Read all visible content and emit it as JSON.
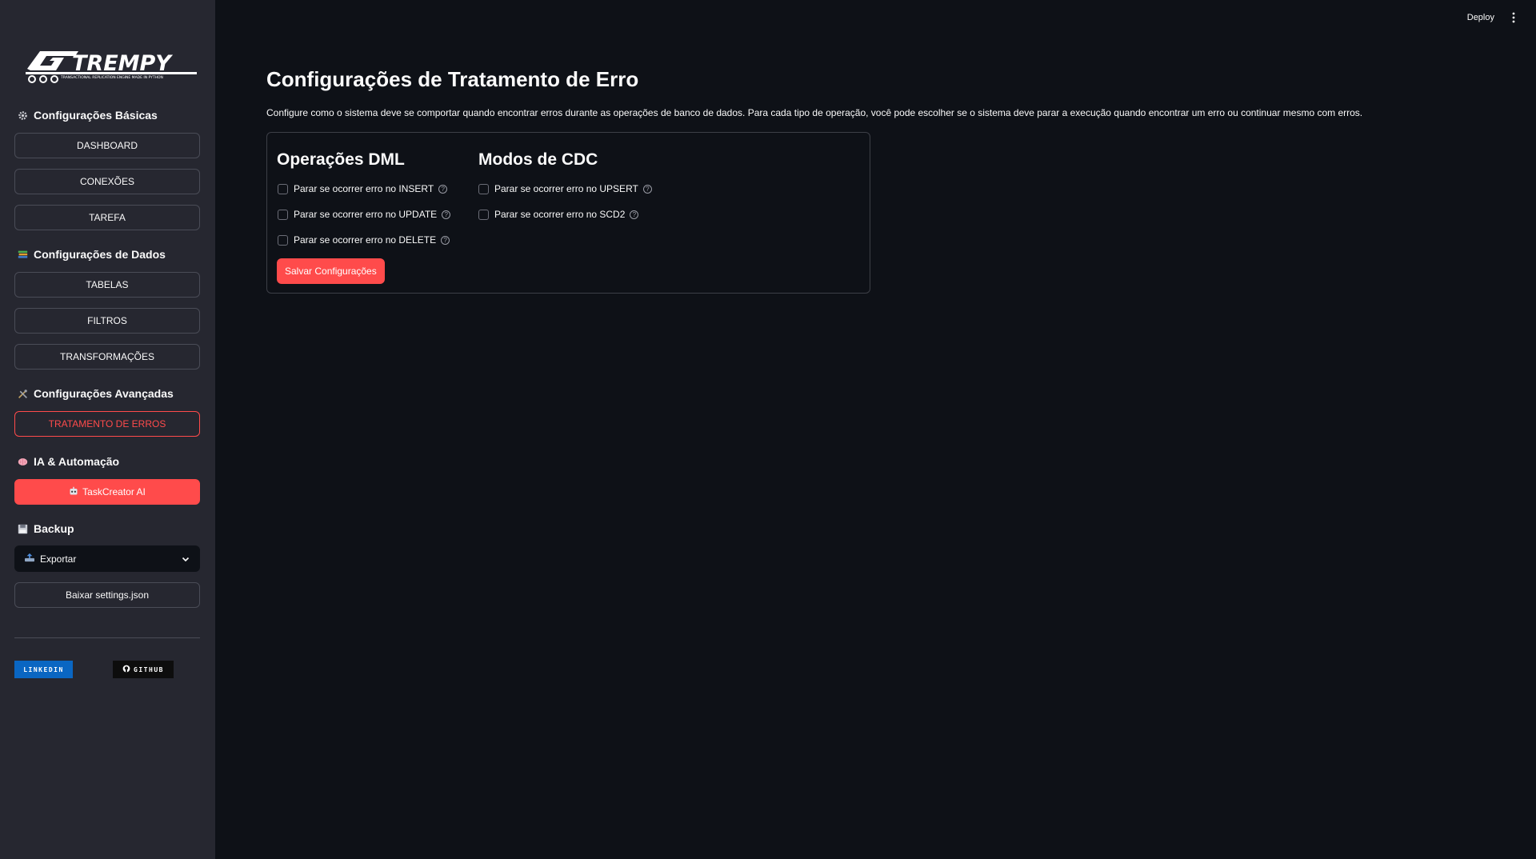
{
  "header": {
    "deploy_label": "Deploy",
    "menu_icon": "kebab-icon"
  },
  "sidebar": {
    "logo_text": "GOTREMPY",
    "logo_tagline": "TRANSACTIONAL REPLICATION ENGINE MADE IN PYTHON",
    "sections": [
      {
        "title": "Configurações Básicas",
        "icon": "gear-icon"
      },
      {
        "title": "Configurações de Dados",
        "icon": "books-icon"
      },
      {
        "title": "Configurações Avançadas",
        "icon": "tools-icon"
      },
      {
        "title": "IA & Automação",
        "icon": "brain-icon"
      },
      {
        "title": "Backup",
        "icon": "floppy-disk-icon"
      }
    ],
    "buttons": {
      "dashboard": "DASHBOARD",
      "conexoes": "CONEXÕES",
      "tarefa": "TAREFA",
      "tabelas": "TABELAS",
      "filtros": "FILTROS",
      "transformacoes": "TRANSFORMAÇÕES",
      "tratamento_erros": "TRATAMENTO DE ERROS",
      "taskcreator": "TaskCreator AI",
      "baixar": "Baixar settings.json"
    },
    "backup_select": {
      "value": "Exportar",
      "icon": "upload-icon"
    },
    "badges": {
      "linkedin": "LINKEDIN",
      "github": "GITHUB"
    }
  },
  "main": {
    "title": "Configurações de Tratamento de Erro",
    "description": "Configure como o sistema deve se comportar quando encontrar erros durante as operações de banco de dados. Para cada tipo de operação, você pode escolher se o sistema deve parar a execução quando encontrar um erro ou continuar mesmo com erros.",
    "dml": {
      "title": "Operações DML",
      "options": [
        {
          "label": "Parar se ocorrer erro no INSERT",
          "checked": false
        },
        {
          "label": "Parar se ocorrer erro no UPDATE",
          "checked": false
        },
        {
          "label": "Parar se ocorrer erro no DELETE",
          "checked": false
        }
      ]
    },
    "cdc": {
      "title": "Modos de CDC",
      "options": [
        {
          "label": "Parar se ocorrer erro no UPSERT",
          "checked": false
        },
        {
          "label": "Parar se ocorrer erro no SCD2",
          "checked": false
        }
      ]
    },
    "save_label": "Salvar Configurações",
    "help_glyph": "?"
  },
  "colors": {
    "accent": "#ff4b4b",
    "background": "#0e1117",
    "sidebar": "#262730"
  }
}
